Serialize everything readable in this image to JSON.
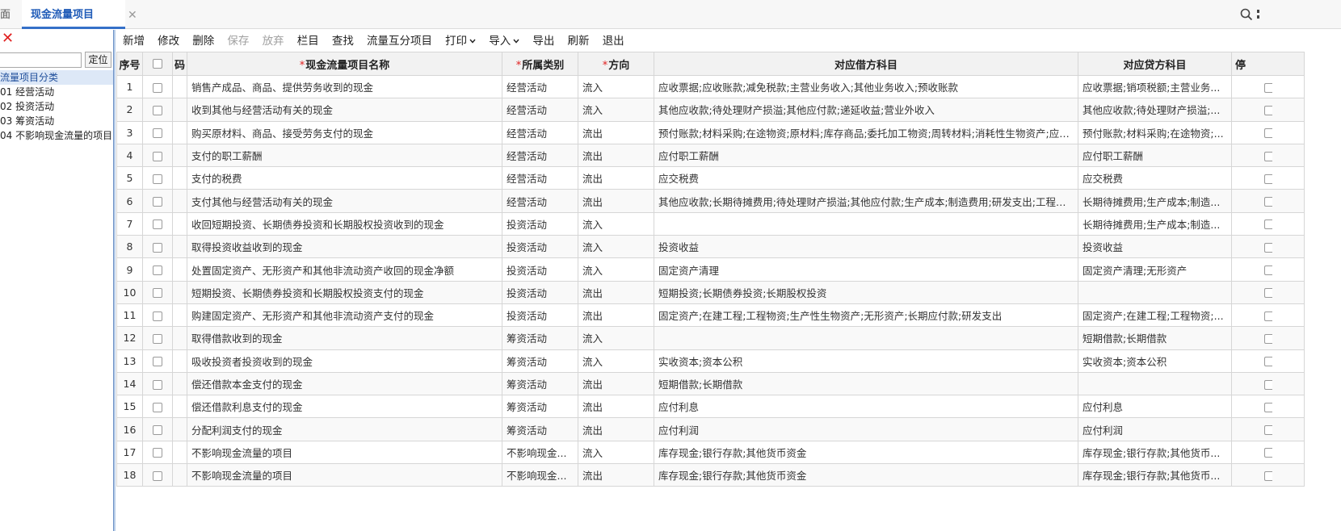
{
  "tabs": {
    "home_label": "面",
    "active_label": "现金流量项目",
    "close_glyph": "✕"
  },
  "icons": {
    "tab_close": "close-icon",
    "panel_close": "close-icon",
    "right_search": "search-icon",
    "right_more": "more-icon"
  },
  "colors": {
    "accent": "#3570c8",
    "active_tab_text": "#1f5bb8",
    "required_mark": "#e02020",
    "splitter": "#b9cde8"
  },
  "left_panel": {
    "close_glyph": "✕",
    "search_value": "",
    "locate_label": "定位",
    "tree": {
      "root": "流量项目分类",
      "children": [
        "01 经营活动",
        "02 投资活动",
        "03 筹资活动",
        "04 不影响现金流量的项目"
      ]
    }
  },
  "toolbar": {
    "buttons": [
      {
        "label": "新增",
        "enabled": true
      },
      {
        "label": "修改",
        "enabled": true
      },
      {
        "label": "删除",
        "enabled": true
      },
      {
        "label": "保存",
        "enabled": false
      },
      {
        "label": "放弃",
        "enabled": false
      },
      {
        "label": "栏目",
        "enabled": true
      },
      {
        "label": "查找",
        "enabled": true
      },
      {
        "label": "流量互分项目",
        "enabled": true
      },
      {
        "label": "打印",
        "enabled": true,
        "dropdown": true
      },
      {
        "label": "导入",
        "enabled": true,
        "dropdown": true
      },
      {
        "label": "导出",
        "enabled": true
      },
      {
        "label": "刷新",
        "enabled": true
      },
      {
        "label": "退出",
        "enabled": true
      }
    ]
  },
  "grid": {
    "columns": {
      "seq": "序号",
      "code": "码",
      "name": "现金流量项目名称",
      "category": "所属类别",
      "direction": "方向",
      "debit": "对应借方科目",
      "credit": "对应贷方科目",
      "stop": "停"
    },
    "required_mark": "*",
    "rows": [
      {
        "seq": "1",
        "name": "销售产成品、商品、提供劳务收到的现金",
        "category": "经营活动",
        "direction": "流入",
        "debit": "应收票据;应收账款;减免税款;主营业务收入;其他业务收入;预收账款",
        "credit": "应收票据;销项税额;主营业务..."
      },
      {
        "seq": "2",
        "name": "收到其他与经营活动有关的现金",
        "category": "经营活动",
        "direction": "流入",
        "debit": "其他应收款;待处理财产损溢;其他应付款;递延收益;营业外收入",
        "credit": "其他应收款;待处理财产损溢;..."
      },
      {
        "seq": "3",
        "name": "购买原材料、商品、接受劳务支付的现金",
        "category": "经营活动",
        "direction": "流出",
        "debit": "预付账款;材料采购;在途物资;原材料;库存商品;委托加工物资;周转材料;消耗性生物资产;应付...",
        "credit": "预付账款;材料采购;在途物资;..."
      },
      {
        "seq": "4",
        "name": "支付的职工薪酬",
        "category": "经营活动",
        "direction": "流出",
        "debit": "应付职工薪酬",
        "credit": "应付职工薪酬"
      },
      {
        "seq": "5",
        "name": "支付的税费",
        "category": "经营活动",
        "direction": "流出",
        "debit": "应交税费",
        "credit": "应交税费"
      },
      {
        "seq": "6",
        "name": "支付其他与经营活动有关的现金",
        "category": "经营活动",
        "direction": "流出",
        "debit": "其他应收款;长期待摊费用;待处理财产损溢;其他应付款;生产成本;制造费用;研发支出;工程施...",
        "credit": "长期待摊费用;生产成本;制造..."
      },
      {
        "seq": "7",
        "name": "收回短期投资、长期债券投资和长期股权投资收到的现金",
        "category": "投资活动",
        "direction": "流入",
        "debit": "",
        "credit": "长期待摊费用;生产成本;制造..."
      },
      {
        "seq": "8",
        "name": "取得投资收益收到的现金",
        "category": "投资活动",
        "direction": "流入",
        "debit": "投资收益",
        "credit": "投资收益"
      },
      {
        "seq": "9",
        "name": "处置固定资产、无形资产和其他非流动资产收回的现金净额",
        "category": "投资活动",
        "direction": "流入",
        "debit": "固定资产清理",
        "credit": "固定资产清理;无形资产"
      },
      {
        "seq": "10",
        "name": "短期投资、长期债券投资和长期股权投资支付的现金",
        "category": "投资活动",
        "direction": "流出",
        "debit": "短期投资;长期债券投资;长期股权投资",
        "credit": ""
      },
      {
        "seq": "11",
        "name": "购建固定资产、无形资产和其他非流动资产支付的现金",
        "category": "投资活动",
        "direction": "流出",
        "debit": "固定资产;在建工程;工程物资;生产性生物资产;无形资产;长期应付款;研发支出",
        "credit": "固定资产;在建工程;工程物资;..."
      },
      {
        "seq": "12",
        "name": "取得借款收到的现金",
        "category": "筹资活动",
        "direction": "流入",
        "debit": "",
        "credit": "短期借款;长期借款"
      },
      {
        "seq": "13",
        "name": "吸收投资者投资收到的现金",
        "category": "筹资活动",
        "direction": "流入",
        "debit": "实收资本;资本公积",
        "credit": "实收资本;资本公积"
      },
      {
        "seq": "14",
        "name": "偿还借款本金支付的现金",
        "category": "筹资活动",
        "direction": "流出",
        "debit": "短期借款;长期借款",
        "credit": ""
      },
      {
        "seq": "15",
        "name": "偿还借款利息支付的现金",
        "category": "筹资活动",
        "direction": "流出",
        "debit": "应付利息",
        "credit": "应付利息"
      },
      {
        "seq": "16",
        "name": "分配利润支付的现金",
        "category": "筹资活动",
        "direction": "流出",
        "debit": "应付利润",
        "credit": "应付利润"
      },
      {
        "seq": "17",
        "name": "不影响现金流量的项目",
        "category": "不影响现金...",
        "direction": "流入",
        "debit": "库存现金;银行存款;其他货币资金",
        "credit": "库存现金;银行存款;其他货币..."
      },
      {
        "seq": "18",
        "name": "不影响现金流量的项目",
        "category": "不影响现金...",
        "direction": "流出",
        "debit": "库存现金;银行存款;其他货币资金",
        "credit": "库存现金;银行存款;其他货币..."
      }
    ]
  }
}
